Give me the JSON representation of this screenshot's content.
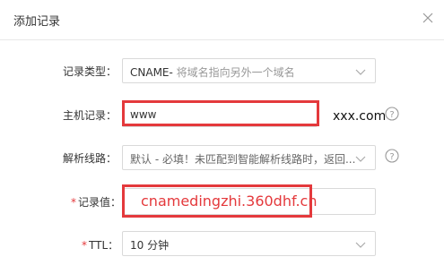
{
  "dialog": {
    "title": "添加记录"
  },
  "form": {
    "record_type": {
      "label": "记录类型：",
      "value_main": "CNAME-",
      "value_hint": " 将域名指向另外一个域名"
    },
    "host_record": {
      "label": "主机记录：",
      "value": "www",
      "suffix": "xxx.com"
    },
    "line": {
      "label": "解析线路：",
      "value": "默认 - 必填！未匹配到智能解析线路时，返回..."
    },
    "record_value": {
      "required_mark": "*",
      "label": "记录值：",
      "value": "cnamedingzhi.360dhf.cn"
    },
    "ttl": {
      "required_mark": "*",
      "label": "TTL：",
      "value": "10 分钟"
    }
  },
  "colors": {
    "highlight_red": "#e4393c",
    "border_gray": "#d9d9d9"
  },
  "icons": {
    "close": "close-icon",
    "chevron": "chevron-down-icon",
    "help": "help-icon"
  }
}
